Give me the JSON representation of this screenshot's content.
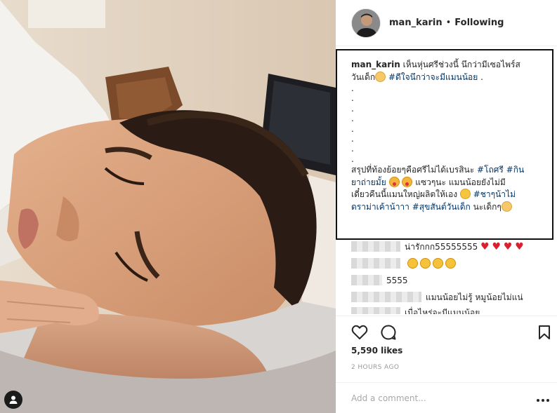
{
  "post": {
    "author": {
      "username": "man_karin",
      "follow_state": "Following",
      "separator": "•"
    },
    "caption": {
      "username": "man_karin",
      "line1": " เห็นหุ่นศรีช่วงนี้ นึกว่ามีเซอไพร์ส",
      "line2_pre": "วันเด็ก",
      "line2_tag": "#ดีใจนึกว่าจะมีแมนน้อย",
      "line2_post": " .",
      "dots": [
        ".",
        ".",
        ".",
        ".",
        ".",
        ".",
        ".",
        "."
      ],
      "line3_pre": "สรุปที่ท้องย้อยๆคือศรีไม่ได้เบรสินะ ",
      "line3_tag1": "#โถศรี",
      "line3_mid": " ",
      "line3_tag2": "#กิน",
      "line4_tag2_cont": "ยาถ่ายมั้ย",
      "line4_post": " แซวๆนะ แมนน้อยยังไม่มี",
      "line5_pre": "เดี๋ยวคืนนี้แมนใหญ่ผลิตให้เอง ",
      "line5_tag": "#ชาๆน้าไม่",
      "line6_tag_cont": "ดราม่าเค้าน้าาา",
      "line6_mid": " ",
      "line6_tag2": "#สุขสันต์วันเด็ก",
      "line6_post": " นะเด็กๆ"
    },
    "comments": [
      {
        "text": "น่ารักกก55555555"
      },
      {
        "text": ""
      },
      {
        "text": "5555"
      },
      {
        "text": "แมนน้อยไม่รู้ หมูน้อยไม่แน่"
      },
      {
        "text": "เมื่อไหร่จะมีแมนน้อย"
      }
    ],
    "likes": "5,590 likes",
    "timestamp": "2 HOURS AGO",
    "add_comment_placeholder": "Add a comment...",
    "icons": {
      "like": "heart-outline-icon",
      "comment": "speech-bubble-icon",
      "save": "bookmark-icon",
      "more": "more-dots-icon",
      "tag": "person-tag-icon"
    }
  }
}
